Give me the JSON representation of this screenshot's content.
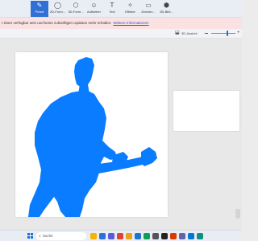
{
  "ribbon": {
    "tools": [
      {
        "label": "Pinsel",
        "icon": "brush-icon",
        "glyph": "✎",
        "active": true
      },
      {
        "label": "2D-Form...",
        "icon": "shapes-2d-icon",
        "glyph": "◯",
        "active": false
      },
      {
        "label": "3D-Form...",
        "icon": "shapes-3d-icon",
        "glyph": "⬡",
        "active": false
      },
      {
        "label": "Aufkleber",
        "icon": "sticker-icon",
        "glyph": "☺",
        "active": false
      },
      {
        "label": "Text",
        "icon": "text-icon",
        "glyph": "T",
        "active": false
      },
      {
        "label": "Effekte",
        "icon": "effects-icon",
        "glyph": "✧",
        "active": false
      },
      {
        "label": "Zeichen...",
        "icon": "canvas-icon",
        "glyph": "▭",
        "active": false
      },
      {
        "label": "3D-Bibl...",
        "icon": "library-3d-icon",
        "glyph": "⬢",
        "active": false
      }
    ],
    "accent": "#2f6fd6"
  },
  "notice": {
    "text": "t Store verfügbar sein und keine zukünftigen Updates mehr erhalten.",
    "link": "Weitere Informationen"
  },
  "viewbar": {
    "view_label": "3D-Ansicht",
    "view_icon": "view-3d-icon",
    "zoom_level": 0.67
  },
  "canvas": {
    "background": "#ffffff",
    "silhouette_color": "#0a7cff",
    "subject": "guitarist-silhouette"
  },
  "taskbar": {
    "search_placeholder": "Suche",
    "apps": [
      {
        "icon": "explorer-icon",
        "color": "#f4b400"
      },
      {
        "icon": "photos-icon",
        "color": "#2f6fd6"
      },
      {
        "icon": "store-icon",
        "color": "#5b5bd6"
      },
      {
        "icon": "chrome-icon",
        "color": "#db4437"
      },
      {
        "icon": "files-icon",
        "color": "#e8a317"
      },
      {
        "icon": "mail-icon",
        "color": "#1976d2"
      },
      {
        "icon": "media-icon",
        "color": "#0f9d58"
      },
      {
        "icon": "settings-icon",
        "color": "#555555"
      },
      {
        "icon": "terminal-icon",
        "color": "#222222"
      },
      {
        "icon": "office-icon",
        "color": "#d83b01"
      },
      {
        "icon": "teams-icon",
        "color": "#6264a7"
      },
      {
        "icon": "paint-icon",
        "color": "#0078d4"
      },
      {
        "icon": "edge-icon",
        "color": "#0f8f7f"
      }
    ]
  }
}
